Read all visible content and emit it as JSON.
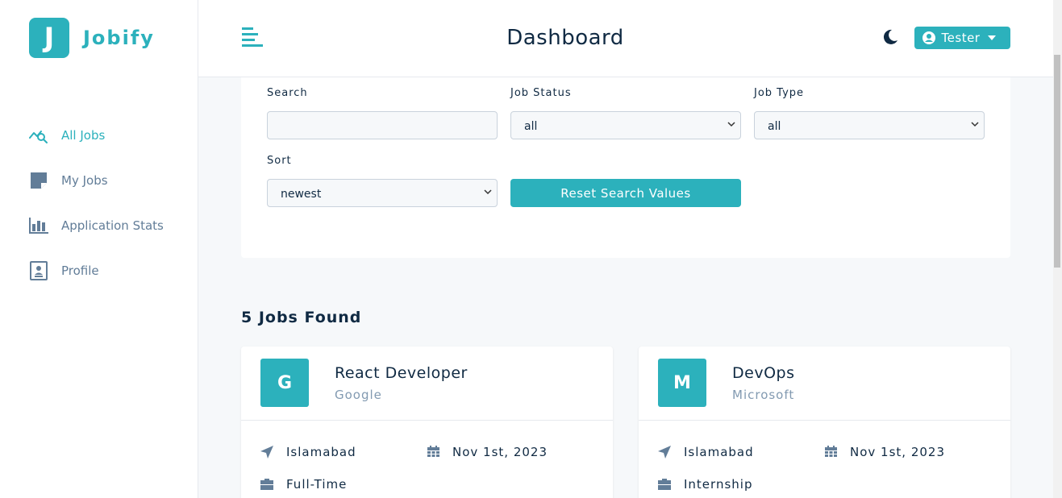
{
  "brand": {
    "letter": "J",
    "name": "Jobify",
    "accent": "#2cb1bc"
  },
  "sidebar": {
    "items": [
      {
        "label": "All Jobs",
        "icon": "chart-search-icon",
        "active": true
      },
      {
        "label": "My Jobs",
        "icon": "sticky-note-icon",
        "active": false
      },
      {
        "label": "Application Stats",
        "icon": "bar-chart-icon",
        "active": false
      },
      {
        "label": "Profile",
        "icon": "id-card-icon",
        "active": false
      }
    ]
  },
  "header": {
    "title": "Dashboard",
    "user_label": "Tester"
  },
  "search_form": {
    "search_label": "Search",
    "search_value": "",
    "status_label": "Job Status",
    "status_value": "all",
    "type_label": "Job Type",
    "type_value": "all",
    "sort_label": "Sort",
    "sort_value": "newest",
    "reset_label": "Reset Search Values"
  },
  "jobs_found": "5 Jobs Found",
  "jobs": [
    {
      "letter": "G",
      "position": "React Developer",
      "company": "Google",
      "location": "Islamabad",
      "date": "Nov 1st, 2023",
      "type": "Full-Time"
    },
    {
      "letter": "M",
      "position": "DevOps",
      "company": "Microsoft",
      "location": "Islamabad",
      "date": "Nov 1st, 2023",
      "type": "Internship"
    }
  ]
}
